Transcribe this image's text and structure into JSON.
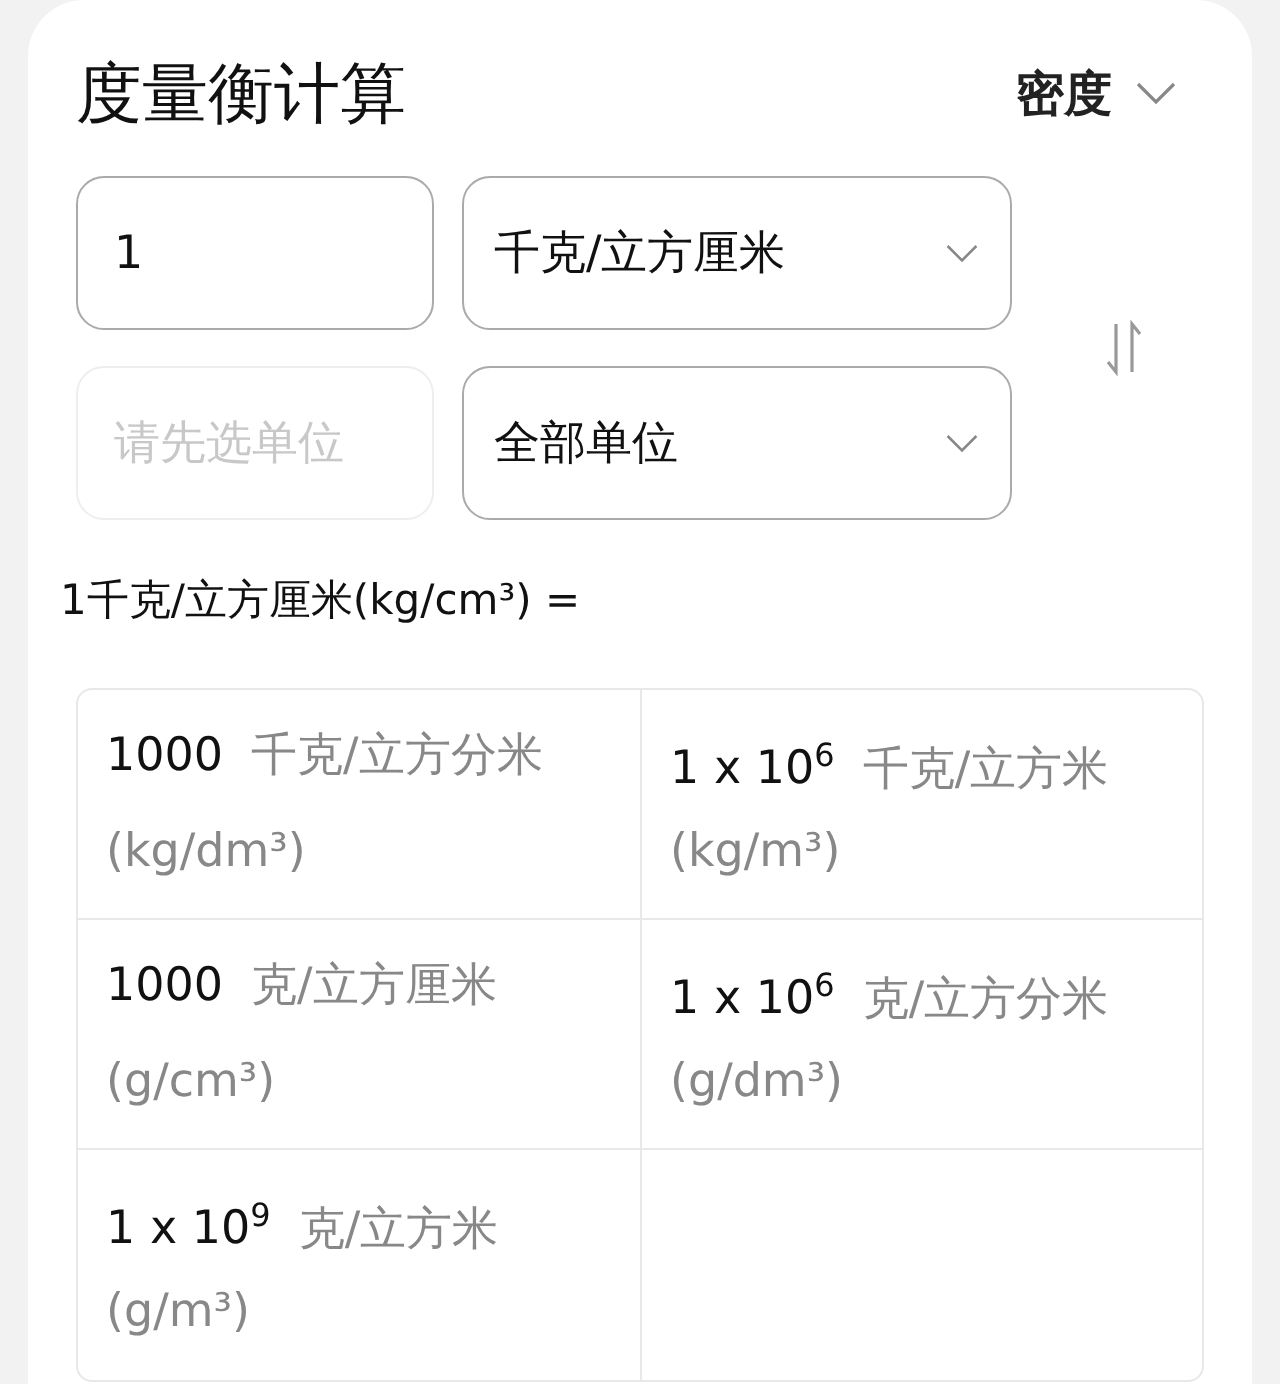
{
  "header": {
    "title": "度量衡计算",
    "category": {
      "label": "密度"
    }
  },
  "input": {
    "value": "1",
    "unit": "千克/立方厘米"
  },
  "output": {
    "placeholder": "请先选单位",
    "disabled": true,
    "unit": "全部单位"
  },
  "result_label": "1千克/立方厘米(kg/cm³) =",
  "results": [
    {
      "value": "1000",
      "unit_name": "千克/立方分米",
      "unit_symbol": "(kg/dm³)"
    },
    {
      "value": "1 x 10$^{6}$",
      "unit_name": "千克/立方米",
      "unit_symbol": "(kg/m³)"
    },
    {
      "value": "1000",
      "unit_name": "克/立方厘米",
      "unit_symbol": "(g/cm³)"
    },
    {
      "value": "1 x 10$^{6}$",
      "unit_name": "克/立方分米",
      "unit_symbol": "(g/dm³)"
    },
    {
      "value": "1 x 10$^{9}$",
      "unit_name": "克/立方米",
      "unit_symbol": "(g/m³)"
    }
  ]
}
